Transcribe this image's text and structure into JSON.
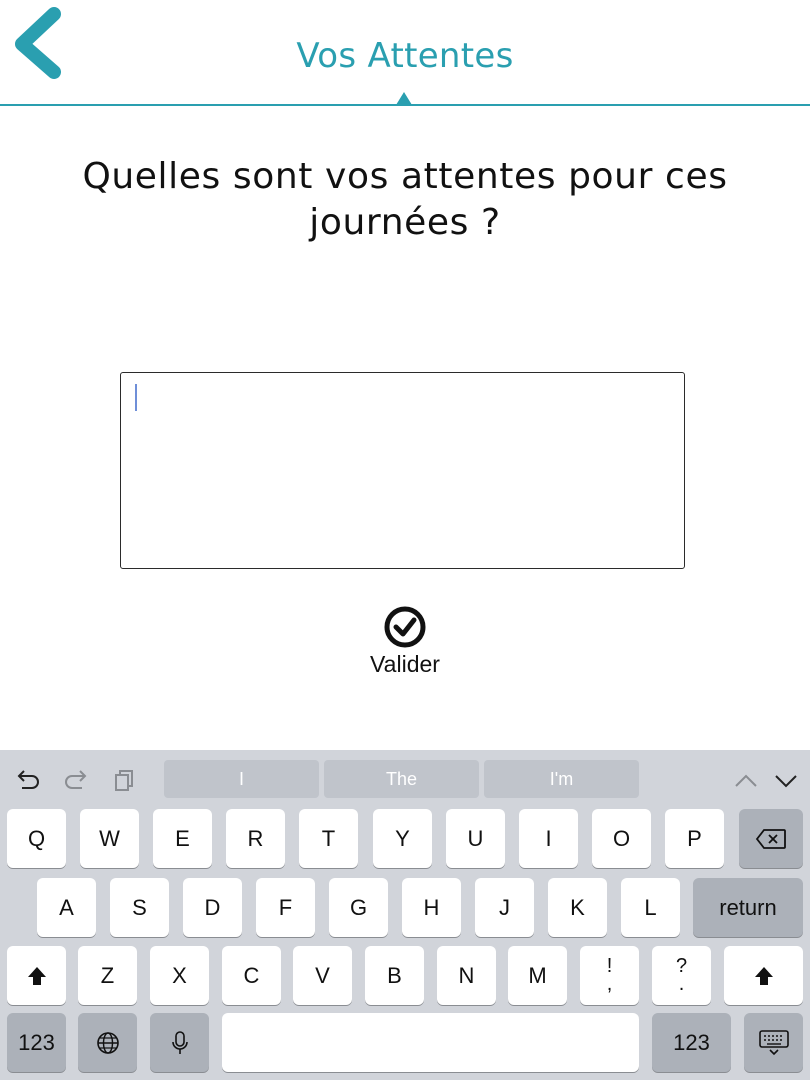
{
  "header": {
    "title": "Vos Attentes",
    "accent_color": "#2a9fb0",
    "back_icon": "chevron-left-icon"
  },
  "main": {
    "question": "Quelles sont vos attentes pour ces journées ?",
    "answer_value": "",
    "validate_label": "Valider",
    "validate_icon": "check-circle-icon"
  },
  "keyboard": {
    "suggestions": [
      "I",
      "The",
      "I'm"
    ],
    "row1": [
      "Q",
      "W",
      "E",
      "R",
      "T",
      "Y",
      "U",
      "I",
      "O",
      "P"
    ],
    "row2": [
      "A",
      "S",
      "D",
      "F",
      "G",
      "H",
      "J",
      "K",
      "L"
    ],
    "return_label": "return",
    "row3": [
      "Z",
      "X",
      "C",
      "V",
      "B",
      "N",
      "M"
    ],
    "exclam_top": "!",
    "exclam_bottom": ",",
    "question_top": "?",
    "question_bottom": ".",
    "numbers_label": "123"
  }
}
